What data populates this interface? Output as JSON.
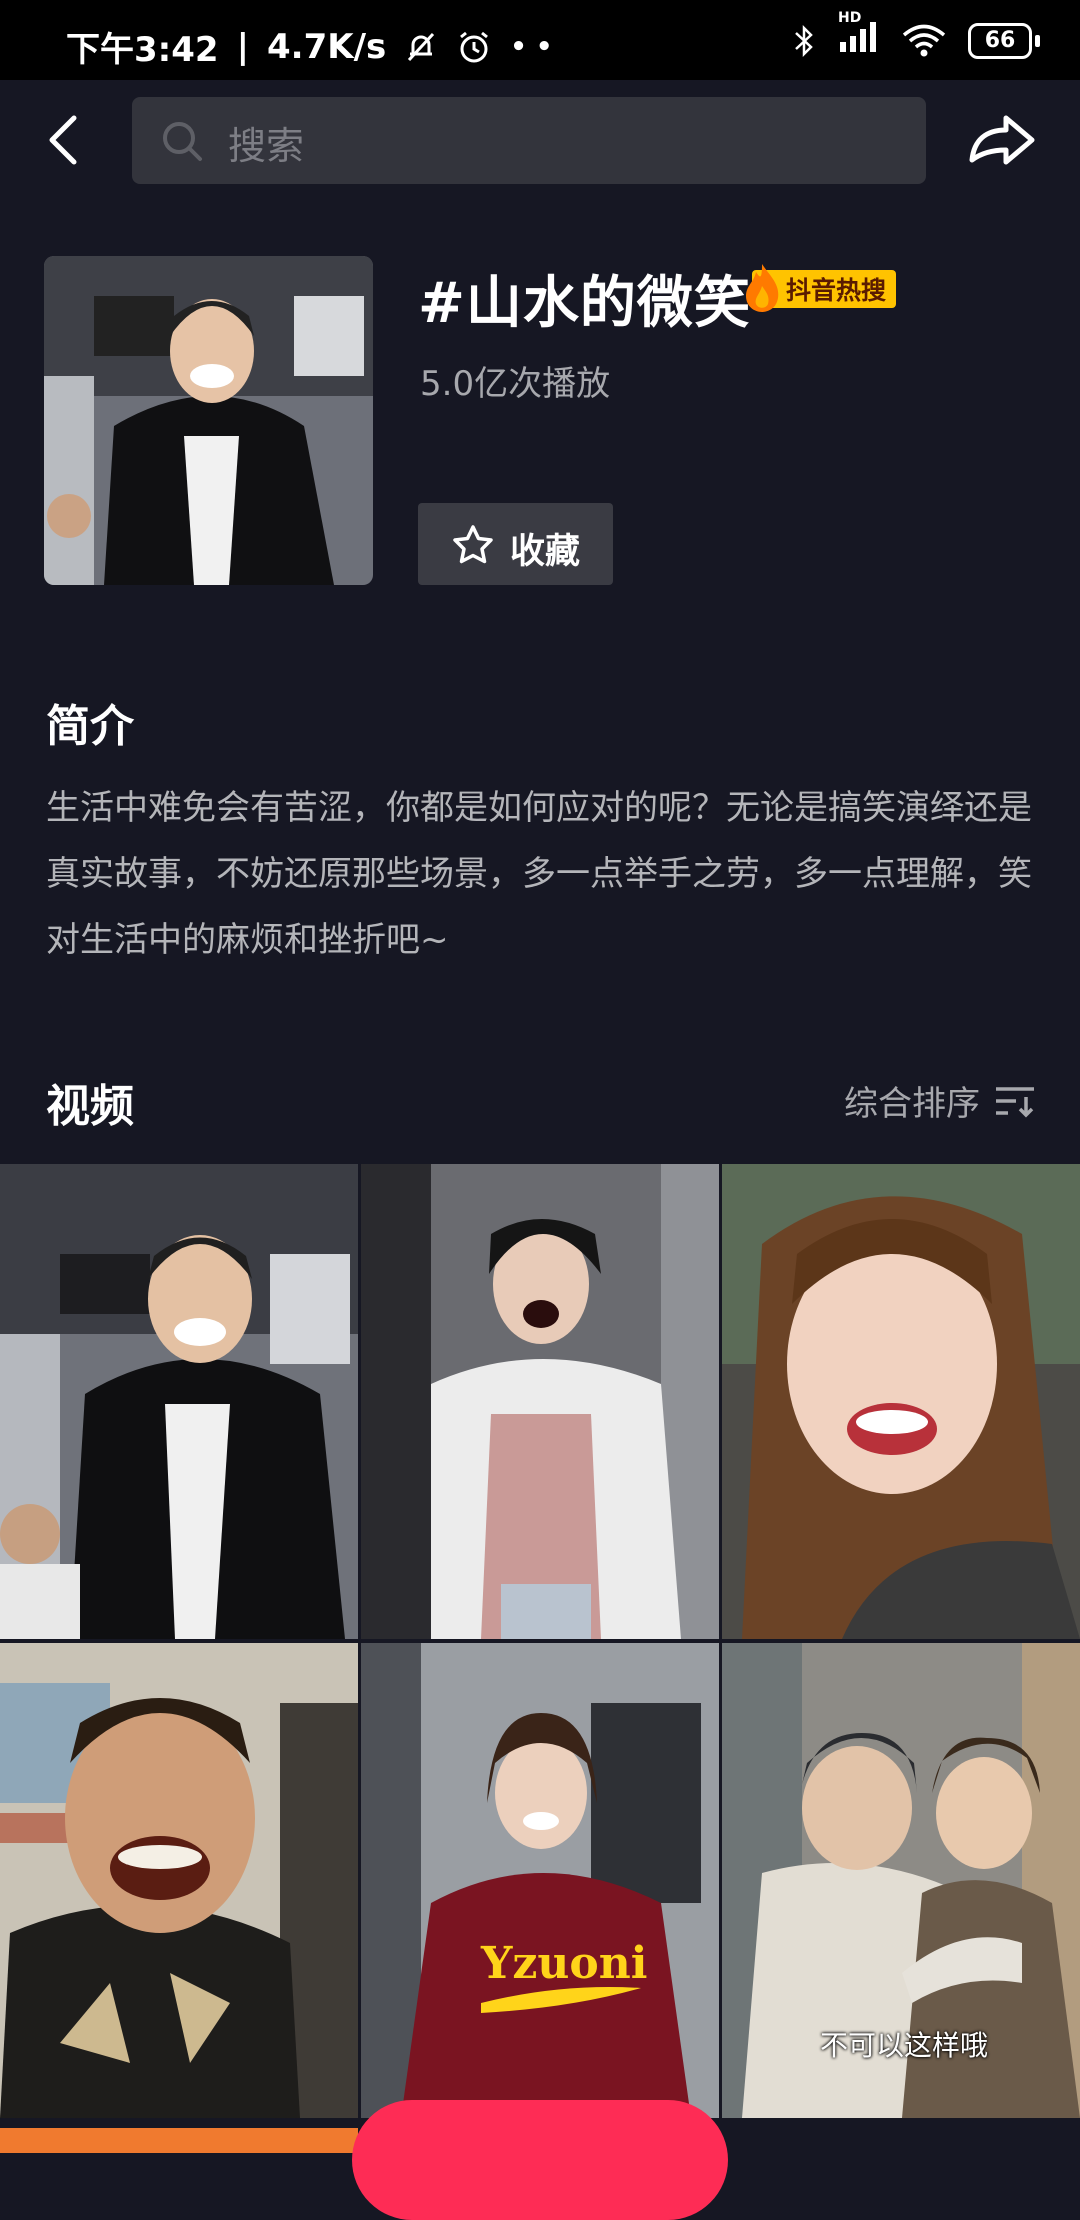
{
  "status_bar": {
    "time": "下午3:42",
    "separator": "|",
    "net_speed": "4.7K/s",
    "battery": "66",
    "hd": "HD"
  },
  "search": {
    "placeholder": "搜索"
  },
  "topic": {
    "title": "#山水的微笑",
    "hot_badge": "抖音热搜",
    "play_count": "5.0亿次播放",
    "favorite_label": "收藏"
  },
  "intro": {
    "heading": "简介",
    "text": "生活中难免会有苦涩，你都是如何应对的呢？无论是搞笑演绎还是真实故事，不妨还原那些场景，多一点举手之劳，多一点理解，笑对生活中的麻烦和挫折吧~"
  },
  "videos": {
    "heading": "视频",
    "sort_label": "综合排序",
    "caption_6": "不可以这样哦",
    "hoodie_text": "Yzuoni"
  },
  "colors": {
    "background": "#161723",
    "accent_red": "#fe2c55",
    "badge_yellow": "#ffc300"
  }
}
